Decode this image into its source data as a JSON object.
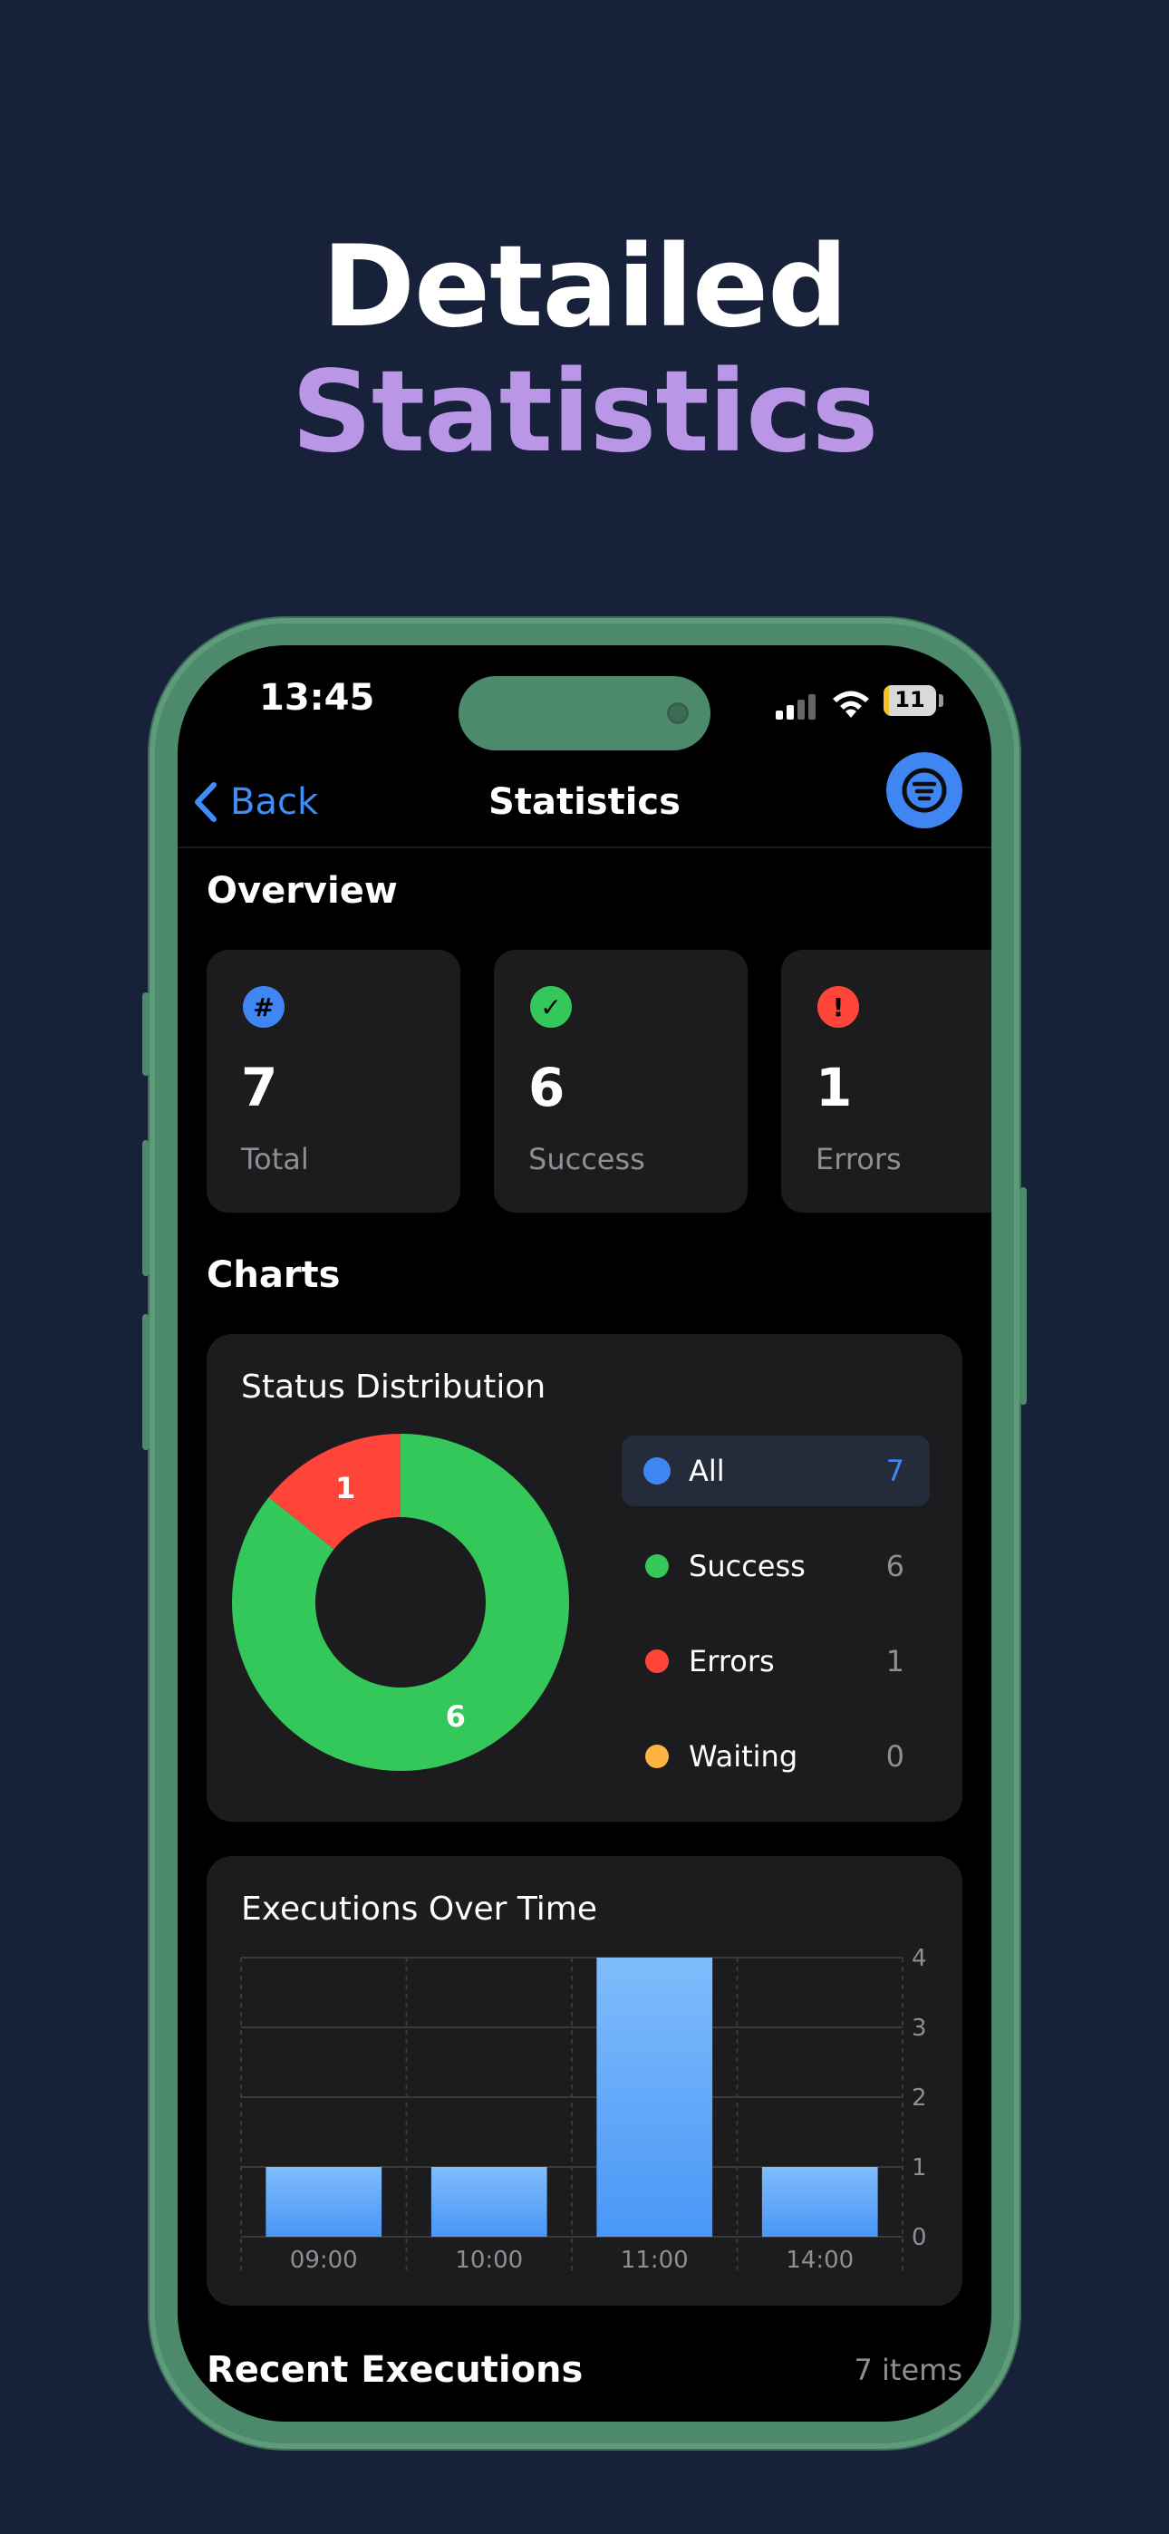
{
  "headline": {
    "line1": "Detailed",
    "line2": "Statistics"
  },
  "status_bar": {
    "time": "13:45",
    "battery": "11",
    "battery_level": 0.11
  },
  "nav": {
    "back_label": "Back",
    "title": "Statistics",
    "filter_icon": "filter-icon"
  },
  "overview": {
    "title": "Overview",
    "cards": [
      {
        "icon": "hash-icon",
        "symbol": "#",
        "value": "7",
        "label": "Total",
        "color": "#3f86f2"
      },
      {
        "icon": "checkmark-icon",
        "symbol": "✓",
        "value": "6",
        "label": "Success",
        "color": "#34c759"
      },
      {
        "icon": "exclamation-icon",
        "symbol": "!",
        "value": "1",
        "label": "Errors",
        "color": "#ff453a"
      }
    ]
  },
  "charts": {
    "title": "Charts"
  },
  "status_distribution": {
    "title": "Status Distribution",
    "legend": [
      {
        "label": "All",
        "count": "7",
        "color": "#3f86f2",
        "selected": true
      },
      {
        "label": "Success",
        "count": "6",
        "color": "#34c759",
        "selected": false
      },
      {
        "label": "Errors",
        "count": "1",
        "color": "#ff453a",
        "selected": false
      },
      {
        "label": "Waiting",
        "count": "0",
        "color": "#ffb340",
        "selected": false
      }
    ]
  },
  "executions_chart": {
    "title": "Executions Over Time"
  },
  "chart_data": [
    {
      "type": "pie",
      "title": "Status Distribution",
      "categories": [
        "Success",
        "Errors"
      ],
      "values": [
        6,
        1
      ],
      "colors": [
        "#34c759",
        "#ff453a"
      ],
      "donut": true
    },
    {
      "type": "bar",
      "title": "Executions Over Time",
      "categories": [
        "09:00",
        "10:00",
        "11:00",
        "14:00"
      ],
      "values": [
        1,
        1,
        4,
        1
      ],
      "ylim": [
        0,
        4
      ],
      "yticks": [
        "0",
        "1",
        "2",
        "3",
        "4"
      ],
      "grid": true,
      "color": "#4a97f7"
    }
  ],
  "recent": {
    "title": "Recent Executions",
    "count": "7 items"
  }
}
